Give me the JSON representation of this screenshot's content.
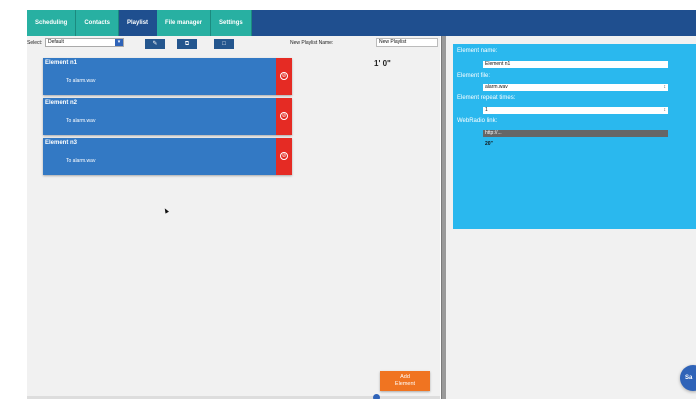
{
  "tabs": [
    {
      "label": "Scheduling",
      "active": false
    },
    {
      "label": "Contacts",
      "active": false
    },
    {
      "label": "Playlist",
      "active": true
    },
    {
      "label": "File manager",
      "active": false
    },
    {
      "label": "Settings",
      "active": false
    }
  ],
  "toolbar": {
    "select_label": "Select:",
    "select_value": "Default",
    "edit_icon": "edit-icon",
    "copy_icon": "copy-icon",
    "new_icon": "new-document-icon",
    "playlist_name_label": "New Playlist Name:",
    "playlist_name_value": "New Playlist"
  },
  "duration": "1' 0\"",
  "elements": [
    {
      "name": "Element n1",
      "file": "To alarm.wav"
    },
    {
      "name": "Element n2",
      "file": "To alarm.wav"
    },
    {
      "name": "Element n3",
      "file": "To alarm.wav"
    }
  ],
  "add_button": {
    "line1": "Add",
    "line2": "Element"
  },
  "properties": {
    "name_label": "Element name:",
    "name_value": "Element n1",
    "file_label": "Element file:",
    "file_value": "alarm.wav",
    "repeat_label": "Element repeat times:",
    "repeat_value": "1",
    "webradio_label": "WebRadio link:",
    "webradio_value": "http://...",
    "seconds_value": "20\""
  },
  "fab_label": "Sa",
  "colors": {
    "tab_bar": "#28b0a2",
    "header": "#1f4f8f",
    "card": "#3379c4",
    "delete": "#e52b24",
    "add": "#f07421",
    "props_panel": "#2ab8ee"
  }
}
